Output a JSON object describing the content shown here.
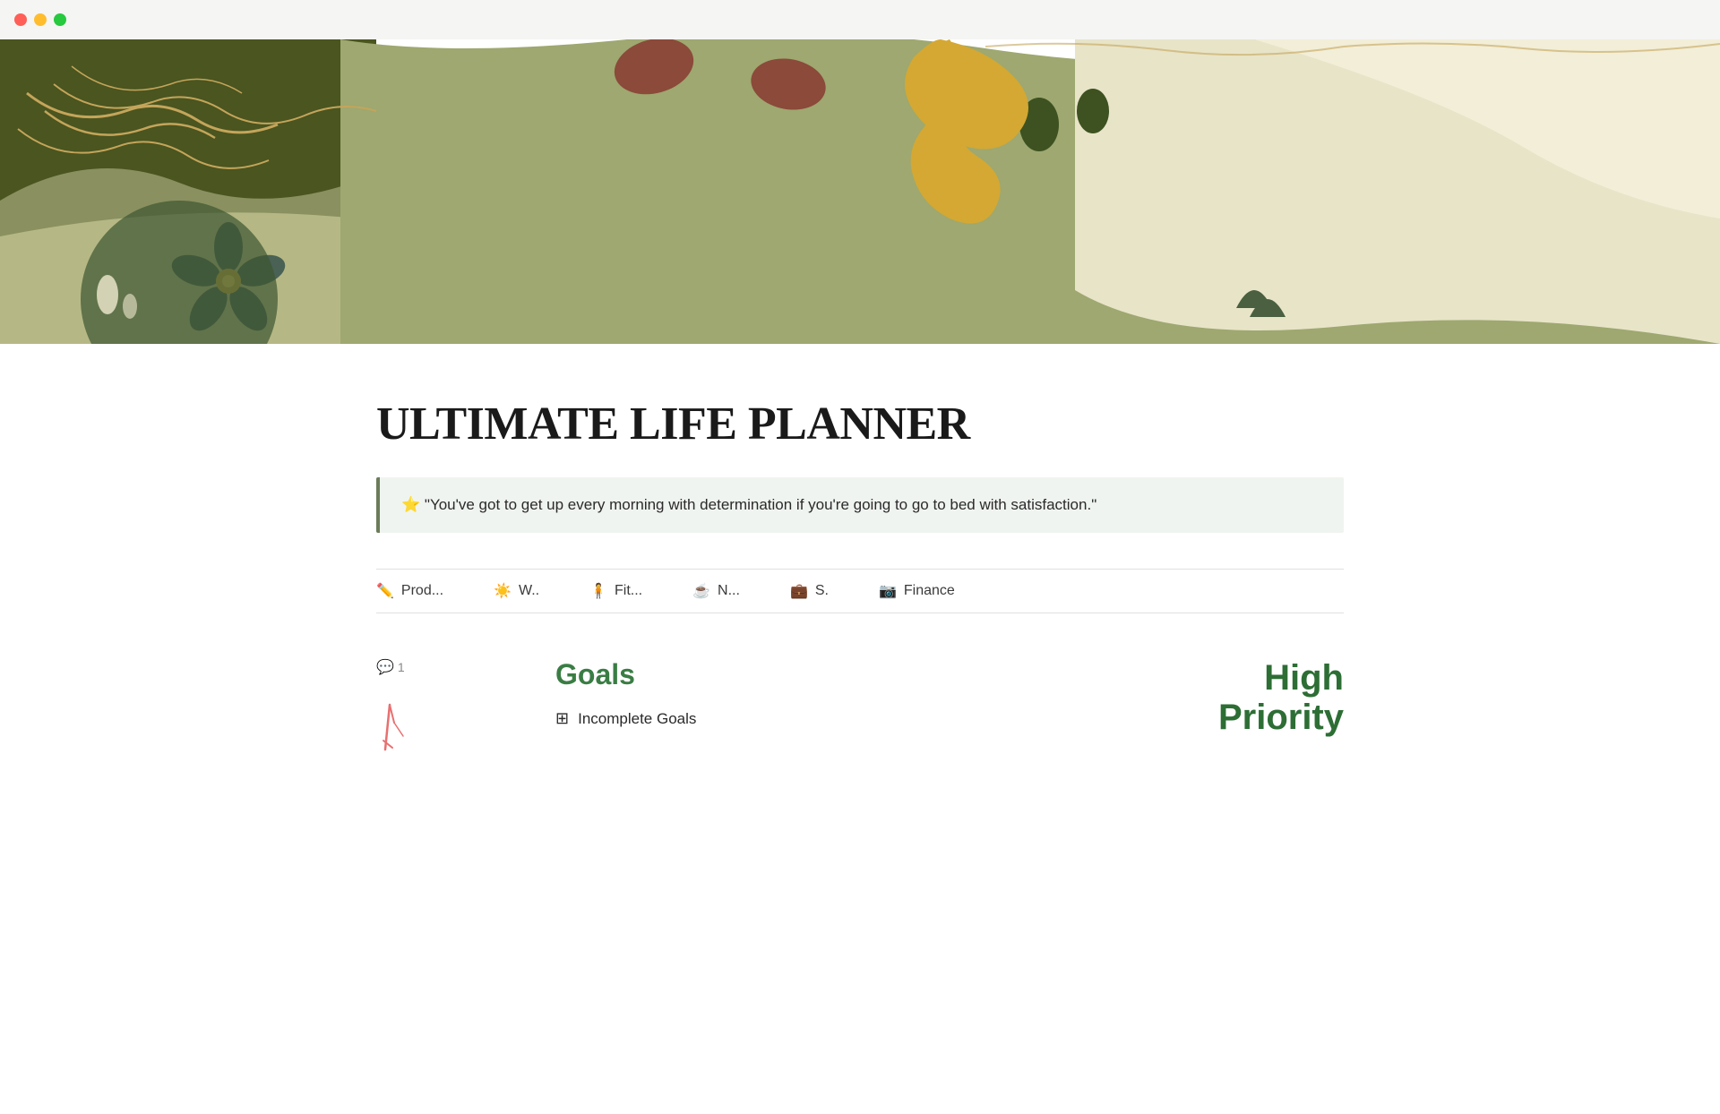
{
  "window": {
    "close_btn": "close",
    "minimize_btn": "minimize",
    "maximize_btn": "maximize"
  },
  "page": {
    "title": "ULTIMATE LIFE PLANNER",
    "quote": {
      "emoji": "⭐",
      "text": "\"You've got to get up every morning with determination if you're going to go to bed with satisfaction.\""
    }
  },
  "nav_tabs": [
    {
      "icon": "✏️",
      "label": "Prod..."
    },
    {
      "icon": "☀️",
      "label": "W.."
    },
    {
      "icon": "👤",
      "label": "Fit..."
    },
    {
      "icon": "☕",
      "label": "N..."
    },
    {
      "icon": "💼",
      "label": "S."
    },
    {
      "icon": "📷",
      "label": "Finance"
    }
  ],
  "goals_section": {
    "comment_count": "1",
    "title": "Goals",
    "incomplete_goals_label": "Incomplete Goals"
  },
  "priority_section": {
    "label": "High\nPriority"
  },
  "colors": {
    "hero_left_dark": "#4a5e1e",
    "hero_left_mid": "#6b7c3a",
    "hero_mid": "#a5a87a",
    "hero_right_light": "#d8d5b0",
    "hero_cream": "#f5f0e0",
    "accent_yellow": "#d4a832",
    "accent_brown": "#8b4a3a",
    "accent_dark_green": "#3d5220",
    "goals_green": "#3a7d44",
    "priority_green": "#2d6e35"
  }
}
